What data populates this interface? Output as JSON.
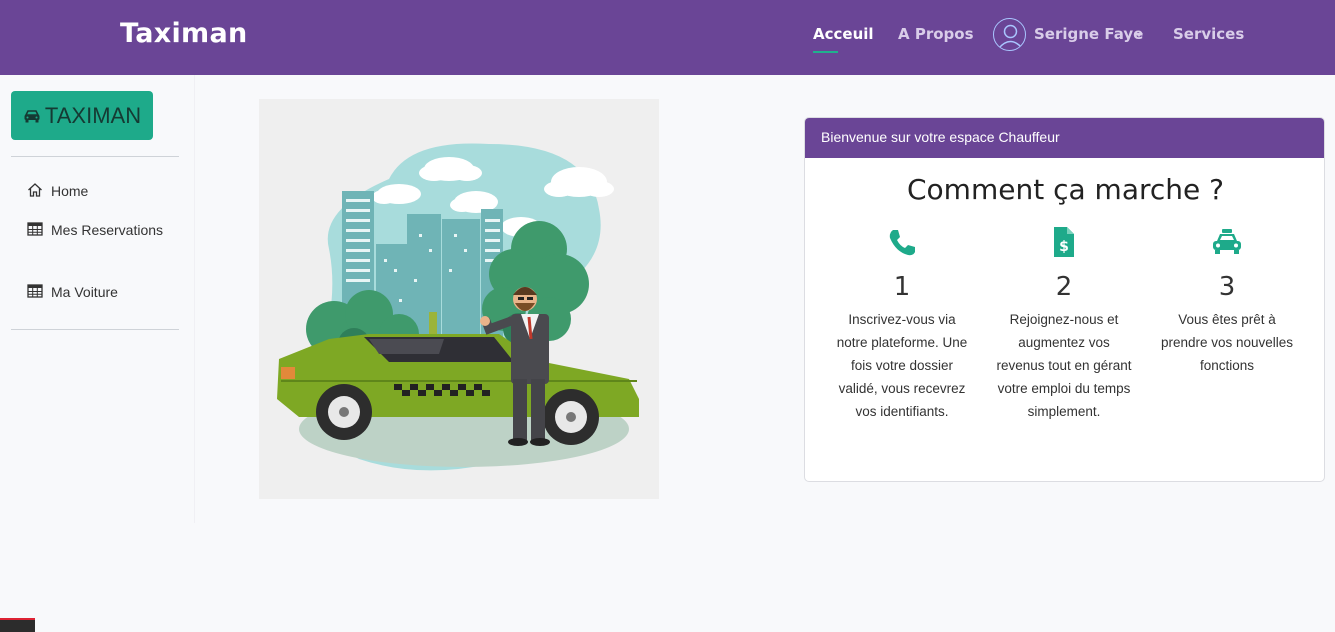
{
  "navbar": {
    "brand": "Taximan",
    "links": [
      {
        "label": "Acceuil",
        "active": true
      },
      {
        "label": "A Propos",
        "active": false
      },
      {
        "label": "Serigne Faye",
        "active": false
      },
      {
        "label": "Services",
        "active": false
      }
    ]
  },
  "sidebar": {
    "brand_label": "TAXIMAN",
    "items": [
      {
        "label": "Home",
        "icon": "home-icon"
      },
      {
        "label": "Mes Reservations",
        "icon": "table-icon"
      },
      {
        "label": "Ma Voiture",
        "icon": "table-icon"
      }
    ]
  },
  "card": {
    "header": "Bienvenue sur votre espace Chauffeur",
    "title": "Comment ça marche ?",
    "steps": [
      {
        "num": "1",
        "icon": "phone-icon",
        "text": "Inscrivez-vous via notre plateforme. Une fois votre dossier validé, vous recevrez vos identifiants."
      },
      {
        "num": "2",
        "icon": "invoice-dollar-icon",
        "text": "Rejoignez-nous et augmentez vos revenus tout en gérant votre emploi du temps simplement."
      },
      {
        "num": "3",
        "icon": "taxi-icon",
        "text": "Vous êtes prêt à prendre vos nouvelles fonctions"
      }
    ]
  },
  "colors": {
    "primary": "#6a4596",
    "accent": "#1eaa8a"
  }
}
